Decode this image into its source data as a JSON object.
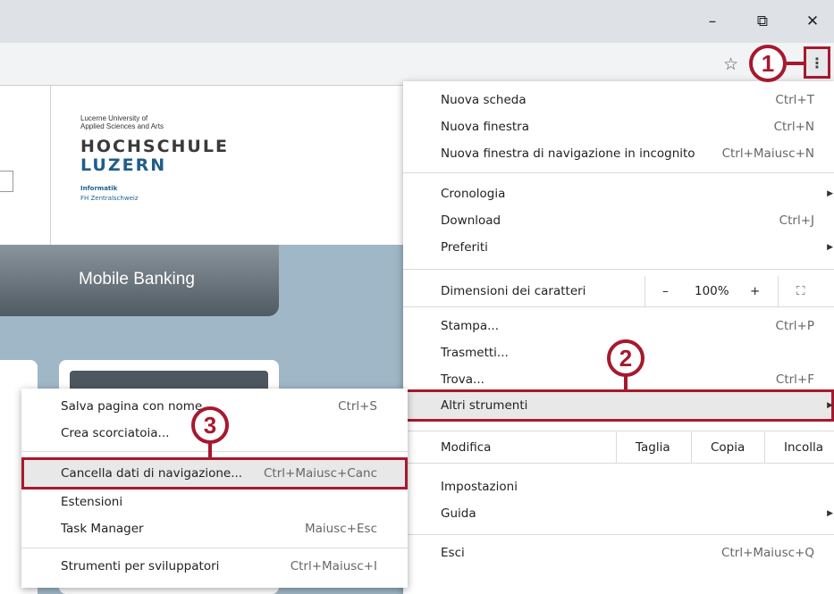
{
  "window_controls": {
    "minimize": "–",
    "restore": "⧉",
    "close": "✕"
  },
  "toolbar": {
    "bookmark_icon": "☆",
    "menu_icon": "⋮"
  },
  "page": {
    "logo": {
      "line1": "Lucerne University of",
      "line2": "Applied Sciences and Arts",
      "line3": "HOCHSCHULE",
      "line4": "LUZERN",
      "line5": "Informatik",
      "line6": "FH Zentralschweiz"
    },
    "mobile_banking": "Mobile Banking"
  },
  "menu": {
    "new_tab": {
      "label": "Nuova scheda",
      "shortcut": "Ctrl+T"
    },
    "new_window": {
      "label": "Nuova finestra",
      "shortcut": "Ctrl+N"
    },
    "incognito": {
      "label": "Nuova finestra di navigazione in incognito",
      "shortcut": "Ctrl+Maiusc+N"
    },
    "history": {
      "label": "Cronologia"
    },
    "downloads": {
      "label": "Download",
      "shortcut": "Ctrl+J"
    },
    "bookmarks": {
      "label": "Preferiti"
    },
    "zoom": {
      "label": "Dimensioni dei caratteri",
      "minus": "–",
      "value": "100%",
      "plus": "+",
      "fullscreen": "⛶"
    },
    "print": {
      "label": "Stampa...",
      "shortcut": "Ctrl+P"
    },
    "cast": {
      "label": "Trasmetti..."
    },
    "find": {
      "label": "Trova...",
      "shortcut": "Ctrl+F"
    },
    "more_tools": {
      "label": "Altri strumenti"
    },
    "edit": {
      "label": "Modifica",
      "cut": "Taglia",
      "copy": "Copia",
      "paste": "Incolla"
    },
    "settings": {
      "label": "Impostazioni"
    },
    "help": {
      "label": "Guida"
    },
    "exit": {
      "label": "Esci",
      "shortcut": "Ctrl+Maiusc+Q"
    }
  },
  "submenu": {
    "save_page": {
      "label": "Salva pagina con nome...",
      "shortcut": "Ctrl+S"
    },
    "create_shortcut": {
      "label": "Crea scorciatoia..."
    },
    "clear_data": {
      "label": "Cancella dati di navigazione...",
      "shortcut": "Ctrl+Maiusc+Canc"
    },
    "extensions": {
      "label": "Estensioni"
    },
    "task_manager": {
      "label": "Task Manager",
      "shortcut": "Maiusc+Esc"
    },
    "dev_tools": {
      "label": "Strumenti per sviluppatori",
      "shortcut": "Ctrl+Maiusc+I"
    }
  },
  "callouts": {
    "one": "1",
    "two": "2",
    "three": "3"
  },
  "colors": {
    "accent": "#a6192e",
    "luzern_blue": "#1f5e8c"
  }
}
